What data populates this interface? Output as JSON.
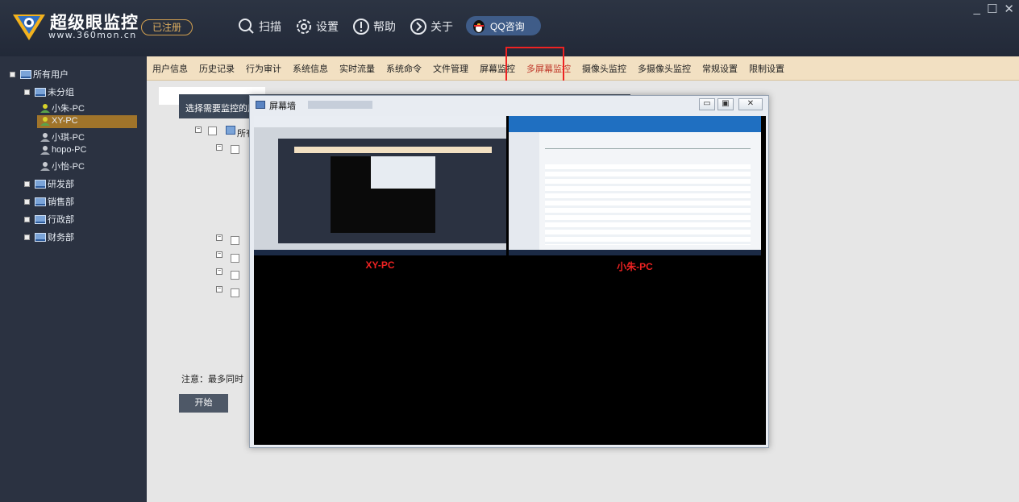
{
  "header": {
    "brand": "超级眼监控",
    "domain": "www.360mon.cn",
    "registered": "已注册",
    "toolbar": [
      {
        "label": "扫描",
        "icon": "search-icon"
      },
      {
        "label": "设置",
        "icon": "gear-icon"
      },
      {
        "label": "帮助",
        "icon": "help-icon"
      },
      {
        "label": "关于",
        "icon": "about-icon"
      }
    ],
    "qq_label": "QQ咨询",
    "window_controls": [
      "_",
      "☐",
      "✕"
    ]
  },
  "sidebar": {
    "root": "所有用户",
    "group": "未分组",
    "pcs": [
      "小朱-PC",
      "XY-PC",
      "小琪-PC",
      "hopo-PC",
      "小怡-PC"
    ],
    "departments": [
      "研发部",
      "销售部",
      "行政部",
      "财务部"
    ],
    "selected": "XY-PC"
  },
  "nav": {
    "items": [
      "用户信息",
      "历史记录",
      "行为审计",
      "系统信息",
      "实时流量",
      "系统命令",
      "文件管理",
      "屏幕监控",
      "多屏幕监控",
      "摄像头监控",
      "多摄像头监控",
      "常规设置",
      "限制设置"
    ],
    "active": "多屏幕监控"
  },
  "main": {
    "panel_title": "选择需要监控的用",
    "tree_root": "所有",
    "note": "注意：最多同时",
    "start": "开始"
  },
  "wall": {
    "title": "屏幕墙",
    "screens": [
      {
        "label": "XY-PC"
      },
      {
        "label": "小朱-PC"
      }
    ],
    "controls": [
      "▭",
      "▣",
      "✕"
    ]
  },
  "colors": {
    "accent": "#a0742a",
    "nav_bg": "#f2e0c2",
    "highlight": "#e22222"
  }
}
